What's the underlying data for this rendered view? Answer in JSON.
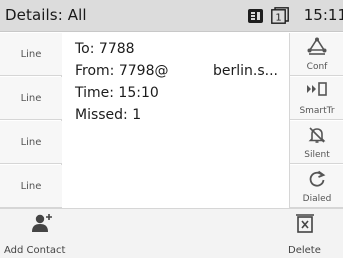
{
  "header": {
    "title": "Details: All",
    "time": "15:11",
    "icons": [
      "line-status-icon",
      "line-1-icon"
    ],
    "line_badge": "1"
  },
  "lines": [
    {
      "label": "Line"
    },
    {
      "label": "Line"
    },
    {
      "label": "Line"
    },
    {
      "label": "Line"
    }
  ],
  "details": {
    "to": "To: 7788",
    "from": "From: 7798@",
    "from_host": "berlin.s...",
    "time": "Time: 15:10",
    "missed": "Missed: 1"
  },
  "softkeys": [
    {
      "label": "Conf",
      "icon": "conference-icon"
    },
    {
      "label": "SmartTr",
      "icon": "smart-transfer-icon"
    },
    {
      "label": "Silent",
      "icon": "silent-bell-icon"
    },
    {
      "label": "Dialed",
      "icon": "redial-icon"
    }
  ],
  "bottom": {
    "add_contact": "Add Contact",
    "delete": "Delete"
  },
  "colors": {
    "header_bg": "#dcdcdc",
    "accent": "#444444"
  }
}
